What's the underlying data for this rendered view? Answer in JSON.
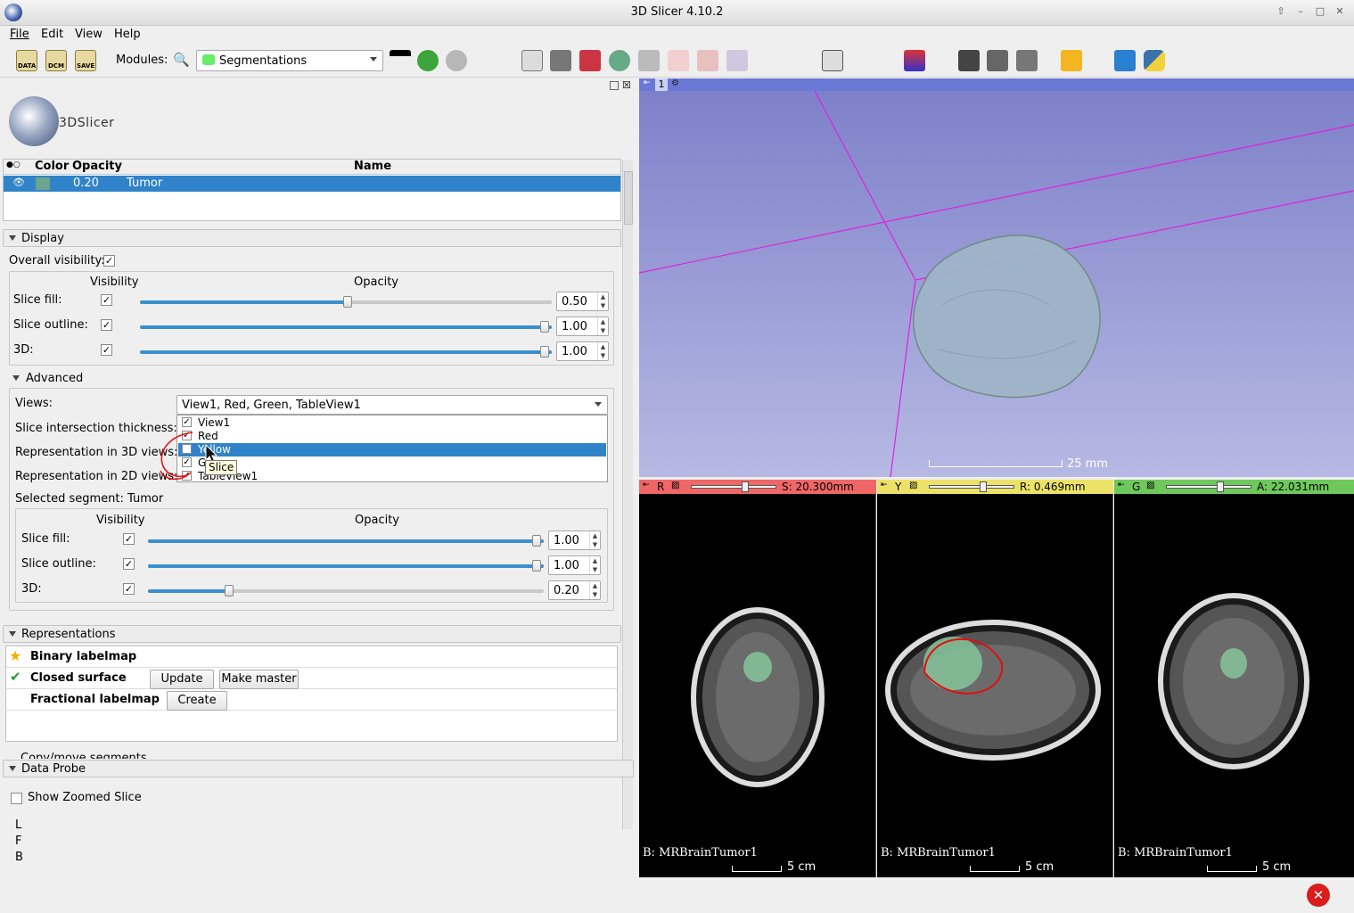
{
  "window": {
    "title": "3D Slicer 4.10.2"
  },
  "menubar": {
    "items": [
      "File",
      "Edit",
      "View",
      "Help"
    ]
  },
  "toolbar": {
    "data_label": "DATA",
    "dcm_label": "DCM",
    "save_label": "SAVE",
    "modules_label": "Modules:",
    "module_selected": "Segmentations"
  },
  "logo": {
    "text": "3DSlicer"
  },
  "segment_table": {
    "headers": [
      "Color",
      "Opacity",
      "Name"
    ],
    "rows": [
      {
        "opacity": "0.20",
        "name": "Tumor",
        "color": "#6aa68e"
      }
    ]
  },
  "display": {
    "section_label": "Display",
    "overall_visibility_label": "Overall visibility:",
    "visibility_header": "Visibility",
    "opacity_header": "Opacity",
    "rows": [
      {
        "label": "Slice fill:",
        "value": "0.50",
        "fraction": 0.5
      },
      {
        "label": "Slice outline:",
        "value": "1.00",
        "fraction": 1.0
      },
      {
        "label": "3D:",
        "value": "1.00",
        "fraction": 1.0
      }
    ],
    "advanced_label": "Advanced",
    "views_label": "Views:",
    "views_value": "View1, Red, Green, TableView1",
    "slice_intersection_label": "Slice intersection thickness:",
    "rep3d_label": "Representation in 3D views:",
    "rep2d_label": "Representation in 2D views:",
    "dropdown_items": [
      {
        "label": "View1",
        "checked": true,
        "highlight": false
      },
      {
        "label": "Red",
        "checked": true,
        "highlight": false
      },
      {
        "label": "Yellow",
        "checked": false,
        "highlight": true
      },
      {
        "label": "Green",
        "checked": true,
        "highlight": false
      },
      {
        "label": "TableView1",
        "checked": true,
        "highlight": false
      }
    ],
    "tooltip": "Slice",
    "selected_segment_label": "Selected segment: Tumor",
    "segment_rows": [
      {
        "label": "Slice fill:",
        "value": "1.00",
        "fraction": 1.0
      },
      {
        "label": "Slice outline:",
        "value": "1.00",
        "fraction": 1.0
      },
      {
        "label": "3D:",
        "value": "0.20",
        "fraction": 0.2
      }
    ]
  },
  "representations": {
    "section_label": "Representations",
    "items": [
      {
        "label": "Binary labelmap",
        "icon": "star-icon"
      },
      {
        "label": "Closed surface",
        "icon": "checkmark-icon",
        "buttons": [
          "Update",
          "Make master"
        ]
      },
      {
        "label": "Fractional labelmap",
        "icon": "",
        "buttons": [
          "Create"
        ]
      }
    ],
    "copy_move_label": "Copy/move segments"
  },
  "data_probe": {
    "section_label": "Data Probe",
    "show_zoomed_label": "Show Zoomed Slice",
    "coords": [
      "L",
      "F",
      "B"
    ]
  },
  "view3d": {
    "tab_number": "1",
    "scale_label": "25 mm"
  },
  "slice_views": [
    {
      "letter": "R",
      "offset": "S: 20.300mm",
      "color": "#f06767",
      "label": "B: MRBrainTumor1",
      "scale": "5 cm"
    },
    {
      "letter": "Y",
      "offset": "R: 0.469mm",
      "color": "#ede268",
      "label": "B: MRBrainTumor1",
      "scale": "5 cm"
    },
    {
      "letter": "G",
      "offset": "A: 22.031mm",
      "color": "#6ec85c",
      "label": "B: MRBrainTumor1",
      "scale": "5 cm"
    }
  ]
}
